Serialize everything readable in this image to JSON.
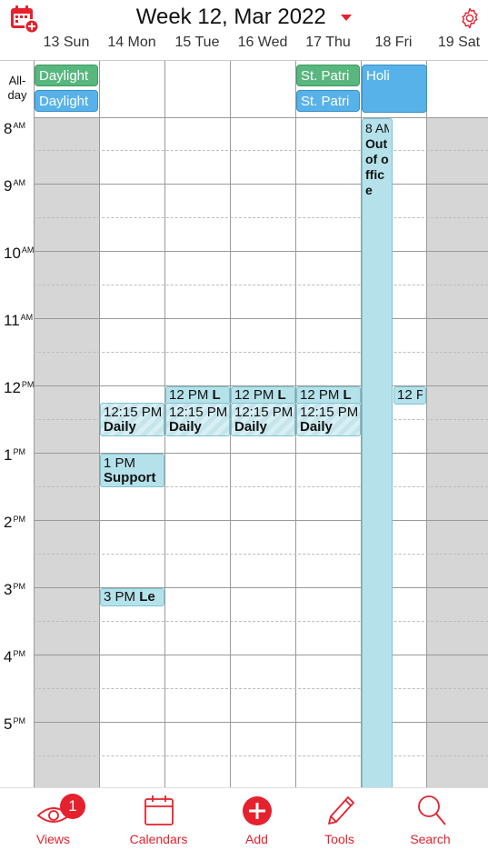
{
  "header": {
    "title": "Week 12, Mar 2022",
    "days": [
      "13 Sun",
      "14 Mon",
      "15 Tue",
      "16 Wed",
      "17 Thu",
      "18 Fri",
      "19 Sat"
    ]
  },
  "grid": {
    "allday_label_line1": "All-",
    "allday_label_line2": "day",
    "hours": [
      {
        "num": "8",
        "suffix": "AM"
      },
      {
        "num": "9",
        "suffix": "AM"
      },
      {
        "num": "10",
        "suffix": "AM"
      },
      {
        "num": "11",
        "suffix": "AM"
      },
      {
        "num": "12",
        "suffix": "PM"
      },
      {
        "num": "1",
        "suffix": "PM"
      },
      {
        "num": "2",
        "suffix": "PM"
      },
      {
        "num": "3",
        "suffix": "PM"
      },
      {
        "num": "4",
        "suffix": "PM"
      },
      {
        "num": "5",
        "suffix": "PM"
      }
    ]
  },
  "allday_events": {
    "sun_1": "Daylight",
    "sun_2": "Daylight",
    "thu_1": "St. Patri",
    "thu_2": "St. Patri",
    "fri_1": "Holi"
  },
  "events": {
    "fri_ooo_time": "8 AM",
    "fri_ooo_title": "Out of office",
    "tue_noon_time": "12 PM",
    "tue_noon_title": "L",
    "wed_noon_time": "12 PM",
    "wed_noon_title": "L",
    "thu_noon_time": "12 PM",
    "thu_noon_title": "L",
    "fri_noon_time": "12 P",
    "mon_daily_time": "12:15 PM",
    "mon_daily_title": "Daily",
    "tue_daily_time": "12:15 PM",
    "tue_daily_title": "Daily",
    "wed_daily_time": "12:15 PM",
    "wed_daily_title": "Daily",
    "thu_daily_time": "12:15 PM",
    "thu_daily_title": "Daily",
    "mon_support_time": "1 PM",
    "mon_support_title": "Support",
    "mon_3pm_time": "3 PM",
    "mon_3pm_title": "Le"
  },
  "tabbar": {
    "views": "Views",
    "views_badge": "1",
    "calendars": "Calendars",
    "add": "Add",
    "tools": "Tools",
    "search": "Search"
  },
  "colors": {
    "accent": "#e5212d",
    "allday_green": "#57b77e",
    "allday_blue": "#58b2ea",
    "event_teal": "#b5e2ea",
    "weekend_gray": "#d6d6d6"
  }
}
